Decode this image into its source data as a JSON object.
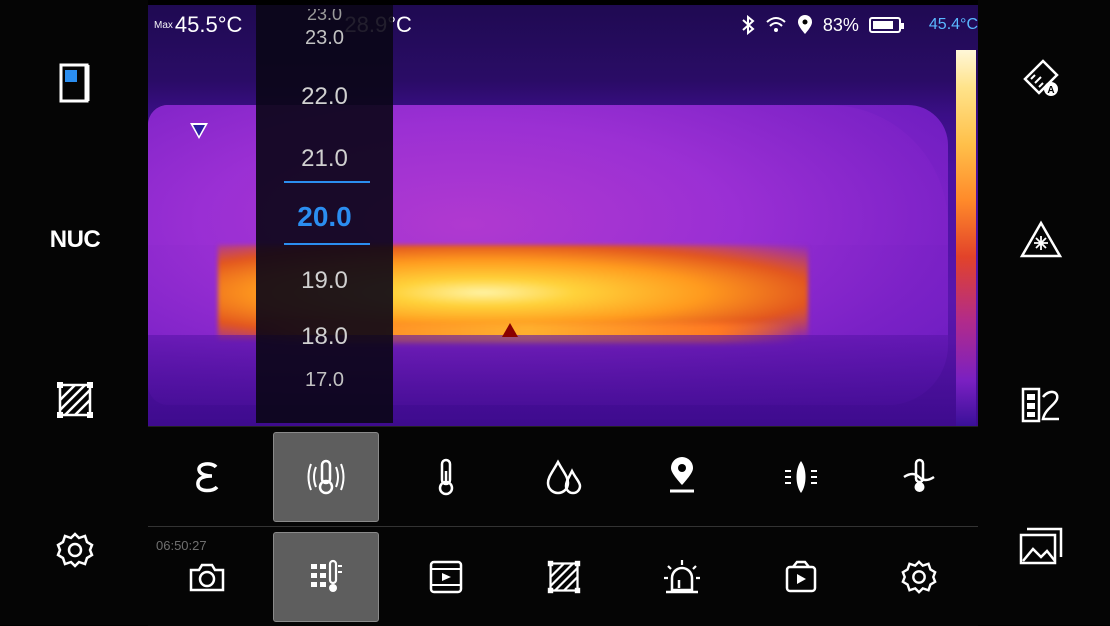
{
  "status_bar": {
    "max_label": "Max",
    "max_value": "45.5°C",
    "min_value": "28.9°C",
    "battery_percent": "83%",
    "battery_level": 0.83
  },
  "scale": {
    "top_value": "45.4°C",
    "top_color": "#5ab8ff"
  },
  "picker": {
    "values_above": [
      "23.0",
      "22.0",
      "21.0"
    ],
    "selected": "20.0",
    "values_below": [
      "19.0",
      "18.0",
      "17.0"
    ],
    "accent": "#2b8ef0"
  },
  "left_rail": {
    "nuc_label": "NUC",
    "icons": [
      "file-icon",
      "area-icon",
      "settings-icon"
    ]
  },
  "right_rail": {
    "icons": [
      "auto-measure-icon",
      "laser-pointer-icon",
      "palette-icon",
      "gallery-icon"
    ]
  },
  "menu_row1": {
    "icons": [
      "emissivity-icon",
      "reflected-temp-icon",
      "thermometer-icon",
      "humidity-icon",
      "location-icon",
      "distance-icon",
      "ambient-temp-icon"
    ],
    "active_index": 1
  },
  "menu_row2": {
    "icons": [
      "camera-icon",
      "temperature-range-icon",
      "video-icon",
      "area-icon",
      "alarm-icon",
      "playback-icon",
      "settings-icon"
    ],
    "active_index": 1
  },
  "ghost_overlay": {
    "time": "06:50:27"
  }
}
